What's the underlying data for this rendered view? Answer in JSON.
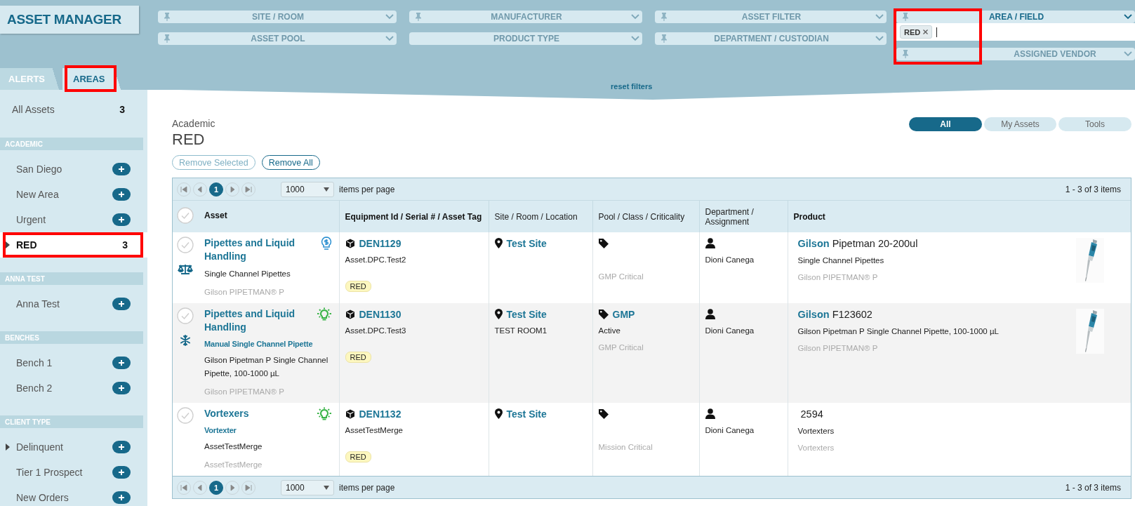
{
  "app_title": "ASSET MANAGER",
  "filters": [
    {
      "label": "SITE / ROOM",
      "pinned": true,
      "active": false
    },
    {
      "label": "MANUFACTURER",
      "pinned": true,
      "active": false
    },
    {
      "label": "ASSET FILTER",
      "pinned": true,
      "active": false
    },
    {
      "label": "ASSET POOL",
      "pinned": true,
      "active": false
    },
    {
      "label": "PRODUCT TYPE",
      "pinned": false,
      "active": false
    },
    {
      "label": "DEPARTMENT / CUSTODIAN",
      "pinned": true,
      "active": false
    }
  ],
  "area_filter": {
    "label": "AREA / FIELD",
    "pinned": true,
    "active": true,
    "highlighted": true,
    "chips": [
      {
        "label": "RED"
      }
    ]
  },
  "vendor_filter": {
    "label": "ASSIGNED VENDOR",
    "pinned": true,
    "active": false
  },
  "reset_filters": "reset filters",
  "sidebar_tabs": [
    {
      "label": "ALERTS",
      "selected": false,
      "highlighted": false
    },
    {
      "label": "AREAS",
      "selected": true,
      "highlighted": true
    }
  ],
  "all_assets": {
    "label": "All Assets",
    "count": "3"
  },
  "area_groups": [
    {
      "heading": "ACADEMIC",
      "items": [
        {
          "label": "San Diego",
          "expandable": false,
          "selected": false,
          "highlighted": false
        },
        {
          "label": "New Area",
          "expandable": false,
          "selected": false,
          "highlighted": false
        },
        {
          "label": "Urgent",
          "expandable": false,
          "selected": false,
          "highlighted": false
        },
        {
          "label": "RED",
          "count": "3",
          "expandable": true,
          "selected": true,
          "highlighted": true
        }
      ]
    },
    {
      "heading": "ANNA TEST",
      "items": [
        {
          "label": "Anna Test",
          "expandable": false,
          "selected": false,
          "highlighted": false
        }
      ]
    },
    {
      "heading": "BENCHES",
      "items": [
        {
          "label": "Bench 1",
          "expandable": false,
          "selected": false,
          "highlighted": false
        },
        {
          "label": "Bench 2",
          "expandable": false,
          "selected": false,
          "highlighted": false
        }
      ]
    },
    {
      "heading": "CLIENT TYPE",
      "items": [
        {
          "label": "Delinquent",
          "expandable": true,
          "selected": false,
          "highlighted": false
        },
        {
          "label": "Tier 1 Prospect",
          "expandable": false,
          "selected": false,
          "highlighted": false
        },
        {
          "label": "New Orders",
          "expandable": false,
          "selected": false,
          "highlighted": false
        }
      ]
    }
  ],
  "breadcrumb": "Academic",
  "title": "RED",
  "actions": [
    {
      "label": "Remove Selected",
      "disabled": true
    },
    {
      "label": "Remove All",
      "disabled": false
    }
  ],
  "views": [
    {
      "label": "All",
      "selected": true
    },
    {
      "label": "My Assets",
      "selected": false
    },
    {
      "label": "Tools",
      "selected": false
    }
  ],
  "table": {
    "pager_top": {
      "page": "1",
      "page_size": "1000",
      "per_page_label": "items per page",
      "summary": "1 - 3 of 3 items"
    },
    "columns": [
      {
        "label": "Asset",
        "kind": "key"
      },
      {
        "label": "Equipment Id / Serial # / Asset Tag",
        "kind": "key"
      },
      {
        "label": "Site / Room / Location",
        "kind": "plain"
      },
      {
        "label": "Pool / Class / Criticality",
        "kind": "plain"
      },
      {
        "label": "Department / Assignment",
        "kind": "plain"
      },
      {
        "label": "Product",
        "kind": "key"
      }
    ],
    "rows": [
      {
        "selected": false,
        "status_icon": {
          "kind": "scale"
        },
        "flag": {
          "kind": "savings",
          "color": "#2a8fd0"
        },
        "asset": {
          "title": "Pipettes and Liquid Handling",
          "description": "Single Channel Pipettes",
          "model": "Gilson PIPETMAN® P"
        },
        "equipment": {
          "id": "DEN1129",
          "serial": "Asset.DPC.Test2",
          "tag": "RED"
        },
        "site": {
          "name": "Test Site"
        },
        "pool": {
          "criticality": "GMP Critical"
        },
        "department": {
          "name": "Dioni Canega"
        },
        "product": {
          "brand": "Gilson",
          "name": "Pipetman 20-200ul",
          "category": "Single Channel Pipettes",
          "model": "Gilson PIPETMAN® P",
          "photo": true
        }
      },
      {
        "selected": false,
        "status_icon": {
          "kind": "snowflake"
        },
        "flag": {
          "kind": "idea",
          "color": "#3cb54a"
        },
        "asset": {
          "title": "Pipettes and Liquid Handling",
          "subtitle": "Manual Single Channel Pipette",
          "description": "Gilson Pipetman P Single Channel Pipette, 100-1000 µL",
          "model": "Gilson PIPETMAN® P"
        },
        "equipment": {
          "id": "DEN1130",
          "serial": "Asset.DPC.Test3",
          "tag": "RED"
        },
        "site": {
          "name": "Test Site",
          "room": "TEST ROOM1"
        },
        "pool": {
          "name": "GMP",
          "status": "Active",
          "criticality": "GMP Critical"
        },
        "department": {
          "name": "Dioni Canega"
        },
        "product": {
          "brand": "Gilson",
          "name": "F123602",
          "category": "Gilson Pipetman P Single Channel Pipette, 100-1000 µL",
          "model": "Gilson PIPETMAN® P",
          "photo": true
        }
      },
      {
        "selected": false,
        "flag": {
          "kind": "idea",
          "color": "#3cb54a"
        },
        "asset": {
          "title": "Vortexers",
          "subtitle": "Vortexter",
          "description": "AssetTestMerge",
          "model": "AssetTestMerge"
        },
        "equipment": {
          "id": "DEN1132",
          "serial": "AssetTestMerge",
          "tag": "RED"
        },
        "site": {
          "name": "Test Site"
        },
        "pool": {
          "criticality": "Mission Critical"
        },
        "department": {
          "name": "Dioni Canega"
        },
        "product": {
          "name": "2594",
          "category": "Vortexters",
          "model": "Vortexters",
          "photo": false
        }
      }
    ],
    "pager_bottom": {
      "page": "1",
      "page_size": "1000",
      "per_page_label": "items per page",
      "summary": "1 - 3 of 3 items"
    }
  }
}
